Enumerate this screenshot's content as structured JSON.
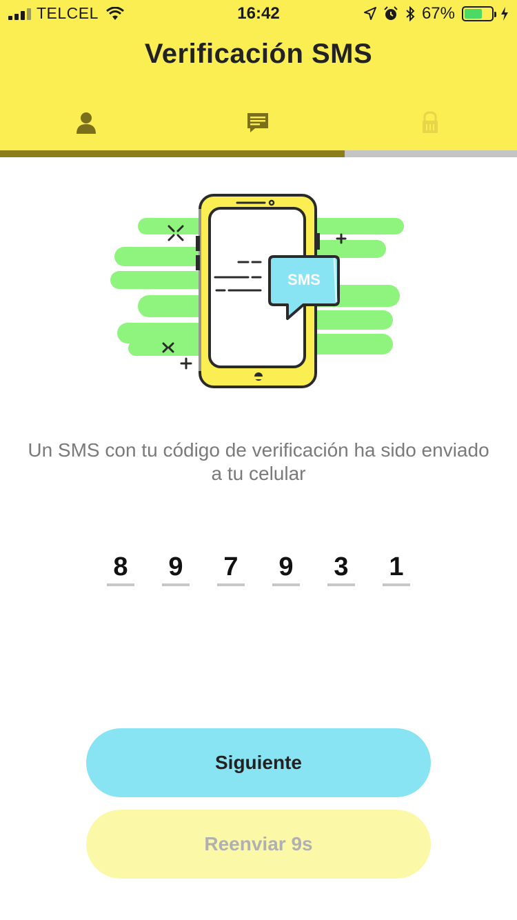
{
  "status_bar": {
    "carrier": "TELCEL",
    "time": "16:42",
    "battery_percent": "67%",
    "battery_level": 0.67,
    "icons": [
      "signal-icon",
      "wifi-icon",
      "location-icon",
      "alarm-icon",
      "bluetooth-icon",
      "battery-icon",
      "charging-icon"
    ]
  },
  "header": {
    "title": "Verificación SMS",
    "steps": [
      {
        "icon": "user-icon",
        "active": false
      },
      {
        "icon": "message-icon",
        "active": true
      },
      {
        "icon": "lock-icon",
        "active": false
      }
    ],
    "progress": 0.667
  },
  "illustration": {
    "bubble_text": "SMS"
  },
  "message": "Un SMS con tu código de verificación ha sido enviado a tu celular",
  "code_digits": [
    "8",
    "9",
    "7",
    "9",
    "3",
    "1"
  ],
  "buttons": {
    "next_label": "Siguiente",
    "resend_label": "Reenviar 9s"
  },
  "colors": {
    "header_bg": "#fbee52",
    "progress_fill": "#8a7d1a",
    "accent_green": "#8ff47e",
    "primary_button": "#88e4f3",
    "secondary_button": "#fbf8a8"
  }
}
